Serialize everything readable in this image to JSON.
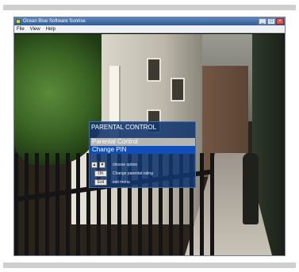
{
  "window": {
    "title": "Ocean Blue Software Sunrise",
    "controls": [
      "_",
      "□",
      "×"
    ]
  },
  "menu": [
    "File",
    "View",
    "Help"
  ],
  "osd": {
    "title": "PARENTAL CONTROL",
    "items": [
      {
        "label": "Parental Control",
        "selected": true
      },
      {
        "label": "Change PIN",
        "selected": false
      }
    ],
    "help": {
      "arrow_up": "▲",
      "arrow_down": "▼",
      "choose": "choose option",
      "ok_key": "OK",
      "ok_text": "Change parental rating",
      "exit_key": "Exit",
      "exit_text": "exit menu"
    }
  },
  "colors": {
    "osd_background": "#12376e",
    "highlight": "#b5b5b5",
    "item_background": "#0f4fb7",
    "titlebar": "#2f5b94"
  }
}
